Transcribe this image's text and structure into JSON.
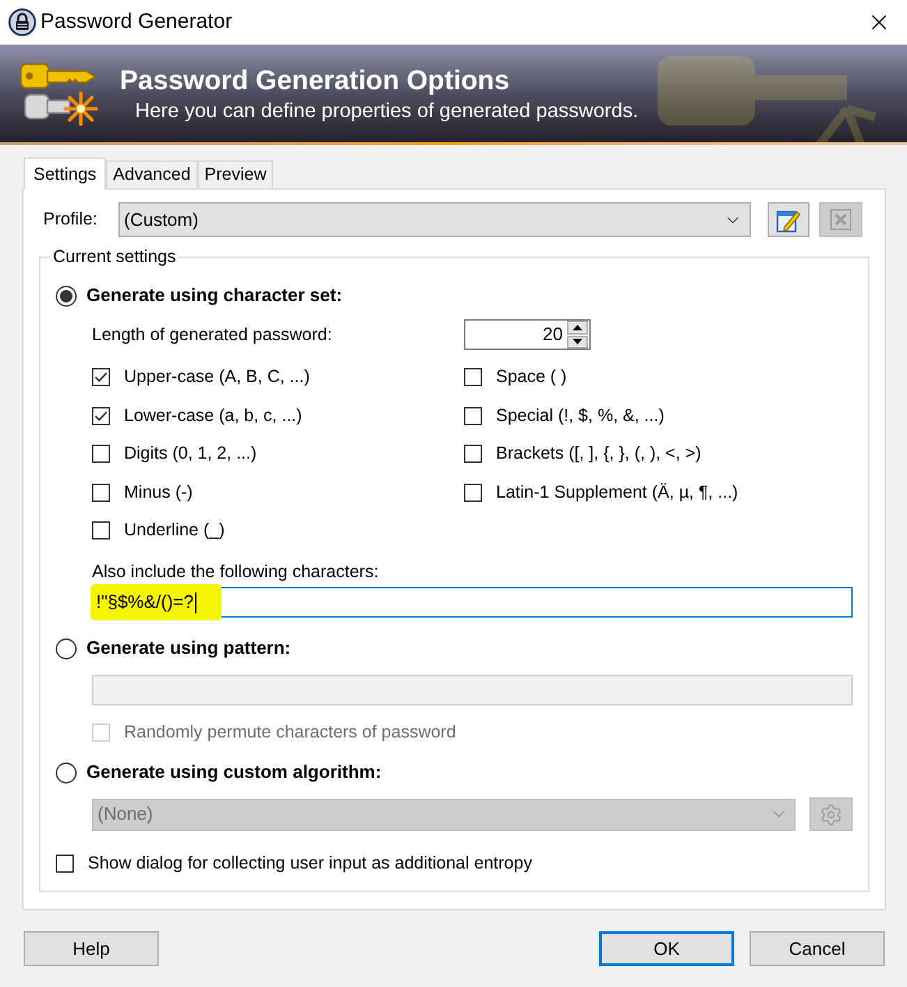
{
  "window": {
    "title": "Password Generator"
  },
  "banner": {
    "title": "Password Generation Options",
    "subtitle": "Here you can define properties of generated passwords."
  },
  "tabs": [
    {
      "label": "Settings",
      "selected": true
    },
    {
      "label": "Advanced",
      "selected": false
    },
    {
      "label": "Preview",
      "selected": false
    }
  ],
  "profile": {
    "label": "Profile:",
    "value": "(Custom)",
    "delete_disabled": true
  },
  "settings_group": {
    "title": "Current settings",
    "modes": [
      {
        "kind": "charset",
        "label": "Generate using character set:",
        "selected": true,
        "length_label": "Length of generated password:",
        "length": "20",
        "option_columns": [
          [
            {
              "label": "Upper-case (A, B, C, ...)",
              "checked": true
            },
            {
              "label": "Lower-case (a, b, c, ...)",
              "checked": true
            },
            {
              "label": "Digits (0, 1, 2, ...)",
              "checked": false
            },
            {
              "label": "Minus (-)",
              "checked": false
            },
            {
              "label": "Underline (_)",
              "checked": false
            }
          ],
          [
            {
              "label": "Space ( )",
              "checked": false
            },
            {
              "label": "Special (!, $, %, &, ...)",
              "checked": false
            },
            {
              "label": "Brackets ([, ], {, }, (, ), <, >)",
              "checked": false
            },
            {
              "label": "Latin-1 Supplement (Ä, µ, ¶, ...)",
              "checked": false
            }
          ]
        ],
        "extra_label": "Also include the following characters:",
        "extra_value": "!\"§$%&/()=?",
        "extra_focused": true,
        "extra_highlighted": true
      },
      {
        "kind": "pattern",
        "label": "Generate using pattern:",
        "selected": false,
        "field_disabled": true,
        "permute": {
          "label": "Randomly permute characters of password",
          "checked": false,
          "disabled": true
        }
      },
      {
        "kind": "algorithm",
        "label": "Generate using custom algorithm:",
        "selected": false,
        "value": "(None)",
        "disabled": true
      }
    ],
    "entropy": {
      "label": "Show dialog for collecting user input as additional entropy",
      "checked": false
    }
  },
  "buttons": [
    {
      "label": "Help",
      "default": false
    },
    {
      "label": "OK",
      "default": true
    },
    {
      "label": "Cancel",
      "default": false
    }
  ]
}
